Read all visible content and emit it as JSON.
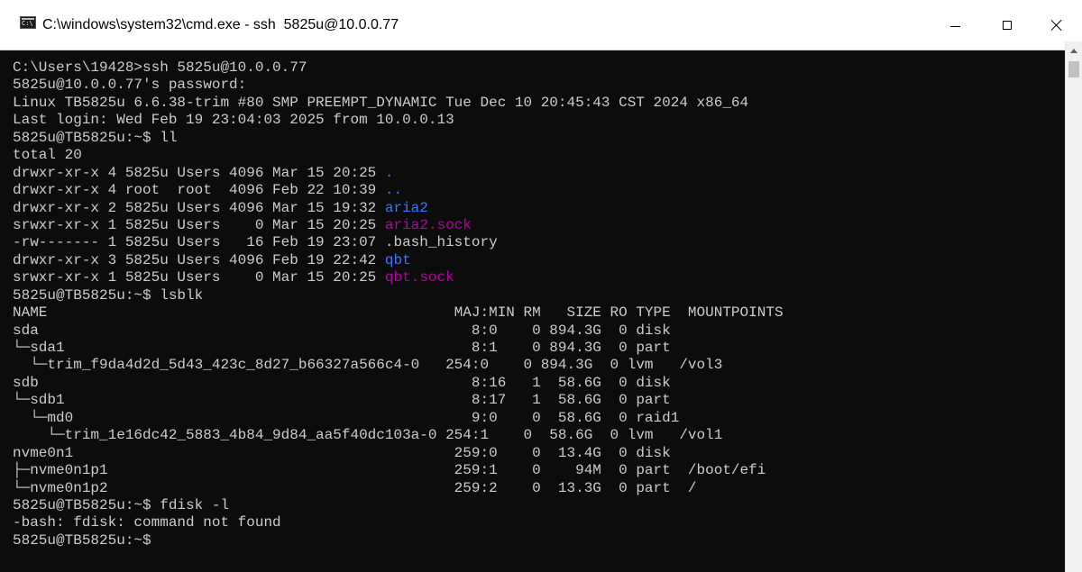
{
  "window": {
    "title": "C:\\windows\\system32\\cmd.exe - ssh  5825u@10.0.0.77",
    "icon": "cmd-console-icon",
    "minimize_icon": "minimize-icon",
    "maximize_icon": "maximize-icon",
    "close_icon": "close-icon"
  },
  "colors": {
    "background": "#0c0c0c",
    "foreground": "#cccccc",
    "directory": "#3b78ff",
    "socket": "#b4009e"
  },
  "terminal": {
    "lines": [
      [
        {
          "text": "C:\\Users\\19428>ssh 5825u@10.0.0.77"
        }
      ],
      [
        {
          "text": "5825u@10.0.0.77's password:"
        }
      ],
      [
        {
          "text": "Linux TB5825u 6.6.38-trim #80 SMP PREEMPT_DYNAMIC Tue Dec 10 20:45:43 CST 2024 x86_64"
        }
      ],
      [
        {
          "text": "Last login: Wed Feb 19 23:04:03 2025 from 10.0.0.13"
        }
      ],
      [
        {
          "text": "5825u@TB5825u:~$ ll"
        }
      ],
      [
        {
          "text": "total 20"
        }
      ],
      [
        {
          "text": "drwxr-xr-x 4 5825u Users 4096 Mar 15 20:25 "
        },
        {
          "text": ".",
          "color": "blue"
        }
      ],
      [
        {
          "text": "drwxr-xr-x 4 root  root  4096 Feb 22 10:39 "
        },
        {
          "text": "..",
          "color": "blue"
        }
      ],
      [
        {
          "text": "drwxr-xr-x 2 5825u Users 4096 Mar 15 19:32 "
        },
        {
          "text": "aria2",
          "color": "blue"
        }
      ],
      [
        {
          "text": "srwxr-xr-x 1 5825u Users    0 Mar 15 20:25 "
        },
        {
          "text": "aria2.sock",
          "color": "purple"
        }
      ],
      [
        {
          "text": "-rw------- 1 5825u Users   16 Feb 19 23:07 .bash_history"
        }
      ],
      [
        {
          "text": "drwxr-xr-x 3 5825u Users 4096 Feb 19 22:42 "
        },
        {
          "text": "qbt",
          "color": "blue"
        }
      ],
      [
        {
          "text": "srwxr-xr-x 1 5825u Users    0 Mar 15 20:25 "
        },
        {
          "text": "qbt.sock",
          "color": "purple"
        }
      ],
      [
        {
          "text": "5825u@TB5825u:~$ lsblk"
        }
      ],
      [
        {
          "text": "NAME                                               MAJ:MIN RM   SIZE RO TYPE  MOUNTPOINTS"
        }
      ],
      [
        {
          "text": "sda                                                  8:0    0 894.3G  0 disk"
        }
      ],
      [
        {
          "text": "└─sda1                                               8:1    0 894.3G  0 part"
        }
      ],
      [
        {
          "text": "  └─trim_f9da4d2d_5d43_423c_8d27_b66327a566c4-0   254:0    0 894.3G  0 lvm   /vol3"
        }
      ],
      [
        {
          "text": "sdb                                                  8:16   1  58.6G  0 disk"
        }
      ],
      [
        {
          "text": "└─sdb1                                               8:17   1  58.6G  0 part"
        }
      ],
      [
        {
          "text": "  └─md0                                              9:0    0  58.6G  0 raid1"
        }
      ],
      [
        {
          "text": "    └─trim_1e16dc42_5883_4b84_9d84_aa5f40dc103a-0 254:1    0  58.6G  0 lvm   /vol1"
        }
      ],
      [
        {
          "text": "nvme0n1                                            259:0    0  13.4G  0 disk"
        }
      ],
      [
        {
          "text": "├─nvme0n1p1                                        259:1    0    94M  0 part  /boot/efi"
        }
      ],
      [
        {
          "text": "└─nvme0n1p2                                        259:2    0  13.3G  0 part  /"
        }
      ],
      [
        {
          "text": "5825u@TB5825u:~$ fdisk -l"
        }
      ],
      [
        {
          "text": "-bash: fdisk: command not found"
        }
      ],
      [
        {
          "text": "5825u@TB5825u:~$ "
        }
      ]
    ]
  }
}
